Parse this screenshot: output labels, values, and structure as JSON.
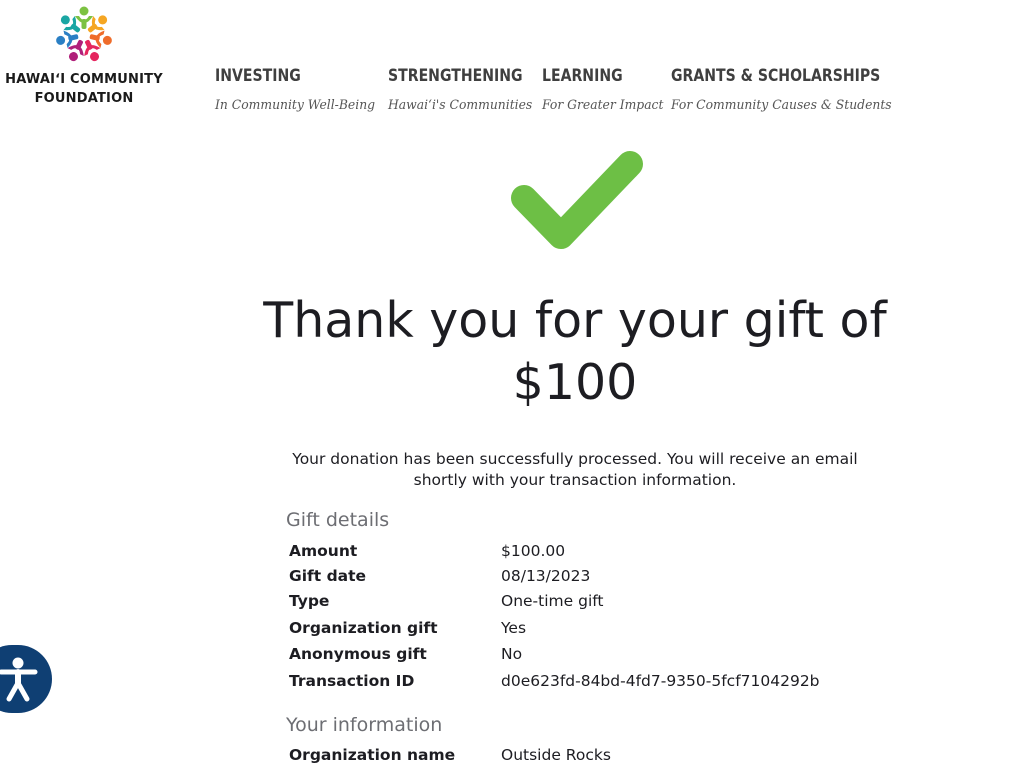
{
  "logo": {
    "line1": "HAWAIʻI COMMUNITY",
    "line2": "FOUNDATION"
  },
  "nav": [
    {
      "title": "INVESTING",
      "subtitle": "In Community Well-Being"
    },
    {
      "title": "STRENGTHENING",
      "subtitle": "Hawaiʻi's Communities"
    },
    {
      "title": "LEARNING",
      "subtitle": "For Greater Impact"
    },
    {
      "title": "GRANTS & SCHOLARSHIPS",
      "subtitle": "For Community Causes & Students"
    }
  ],
  "confirmation": {
    "headline_line1": "Thank you for your gift of",
    "headline_line2": "$100",
    "message": "Your donation has been successfully processed. You will receive an email shortly with your transaction information."
  },
  "gift_details": {
    "title": "Gift details",
    "rows": [
      {
        "label": "Amount",
        "value": "$100.00"
      },
      {
        "label": "Gift date",
        "value": "08/13/2023"
      },
      {
        "label": "Type",
        "value": "One-time gift"
      },
      {
        "label": "Organization gift",
        "value": "Yes"
      },
      {
        "label": "Anonymous gift",
        "value": "No"
      },
      {
        "label": "Transaction ID",
        "value": "d0e623fd-84bd-4fd7-9350-5fcf7104292b"
      }
    ]
  },
  "your_information": {
    "title": "Your information",
    "rows": [
      {
        "label": "Organization name",
        "value": "Outside Rocks"
      }
    ]
  },
  "icons": {
    "logo": "flower-people-logo-icon",
    "success": "check-mark-icon",
    "accessibility": "accessibility-person-icon"
  },
  "colors": {
    "success_green": "#6dbf45",
    "accessibility_bg": "#0f3f73",
    "nav_title": "#3f3f3f",
    "section_title": "#6d6e73"
  }
}
